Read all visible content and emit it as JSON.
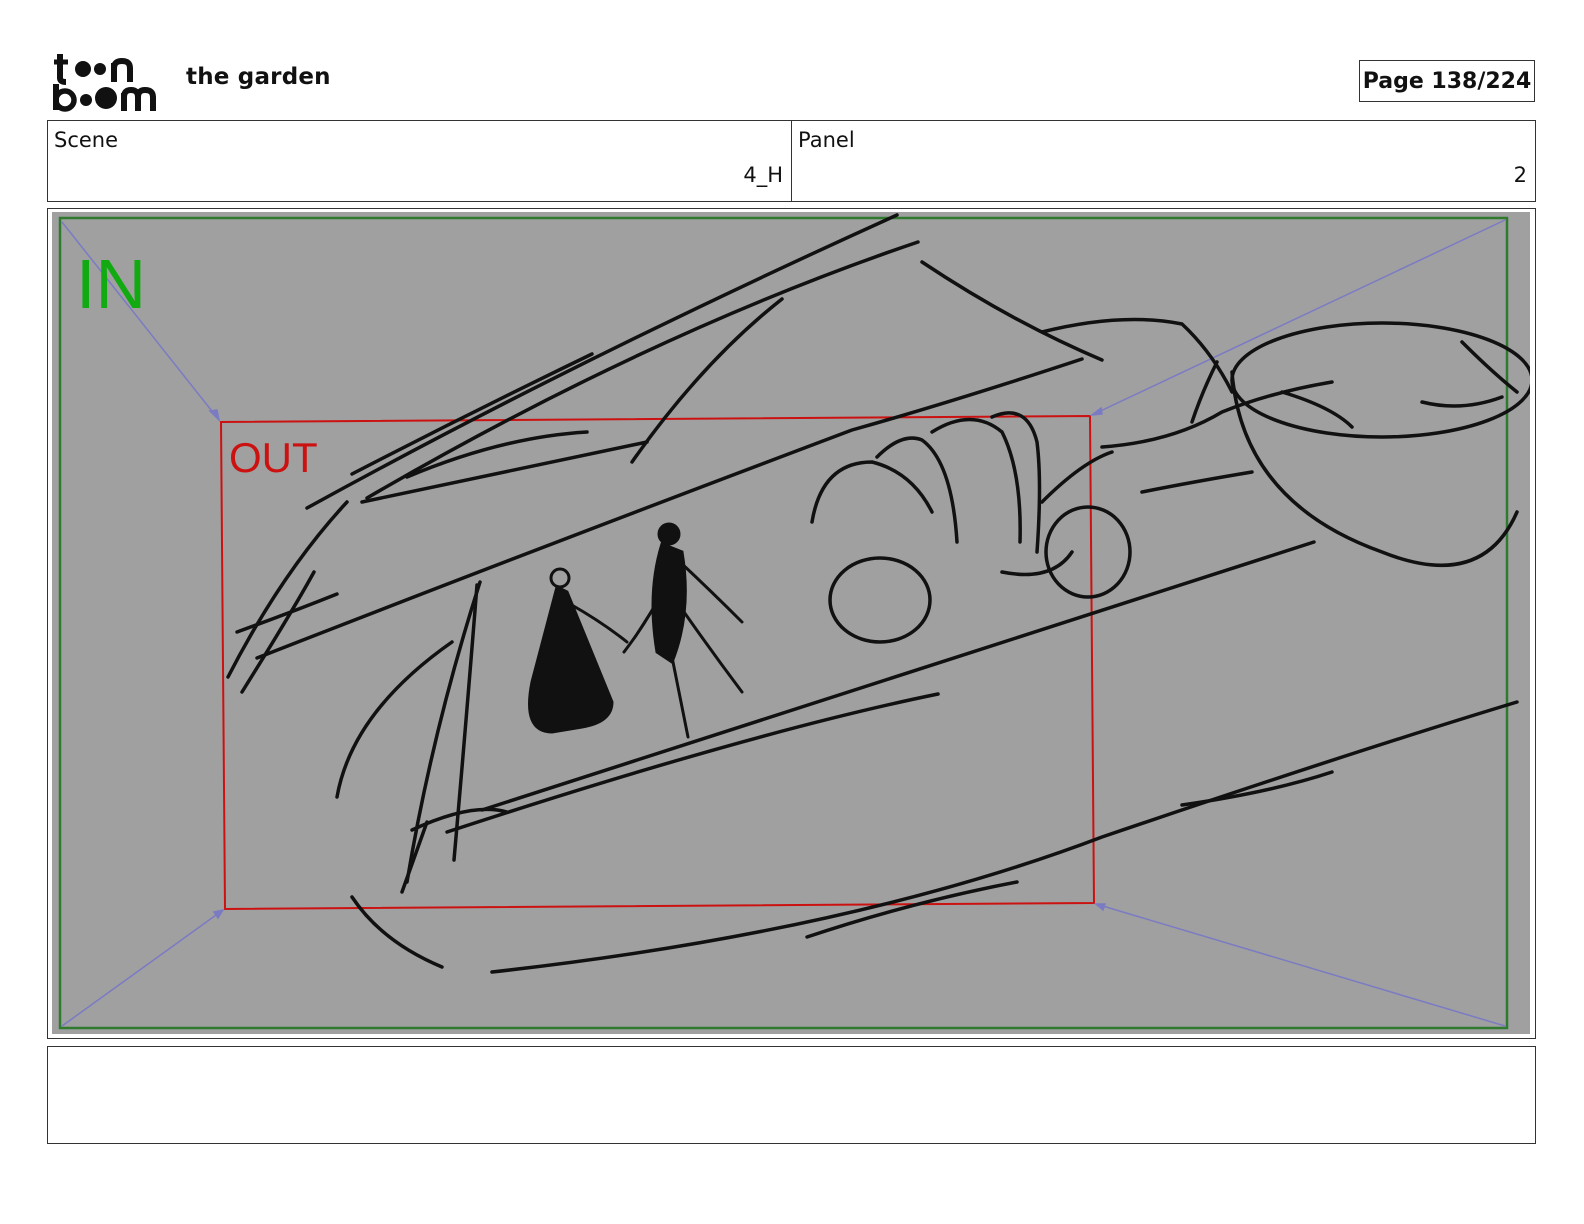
{
  "header": {
    "logo_text_top": "toon",
    "logo_text_bottom": "boom",
    "project_title": "the garden",
    "page_label": "Page 138/224"
  },
  "info": {
    "scene_label": "Scene",
    "scene_value": "4_H",
    "panel_label": "Panel",
    "panel_value": "2"
  },
  "panel": {
    "in_label": "IN",
    "out_label": "OUT",
    "colors": {
      "canvas": "#a0a0a0",
      "in_frame": "#2f7a2f",
      "in_text": "#11aa11",
      "out_frame": "#cc1111",
      "out_text": "#cc1111",
      "motion_arrows": "#7b7bc4",
      "sketch_ink": "#111111"
    }
  },
  "notes": {
    "text": ""
  }
}
